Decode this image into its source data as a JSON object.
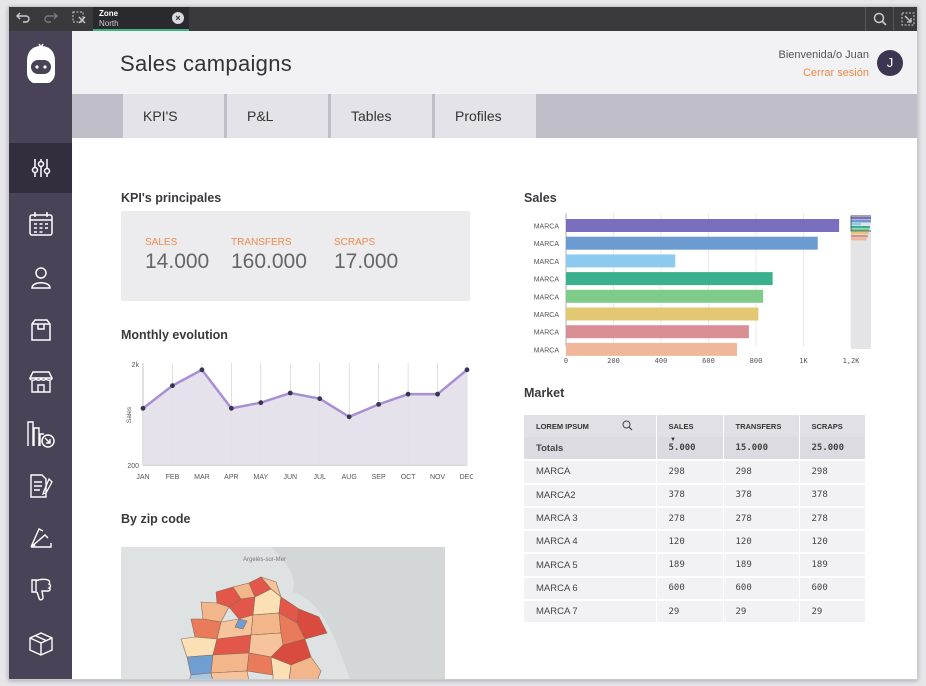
{
  "toolbar": {
    "undo_icon": "undo-icon",
    "redo_icon": "redo-icon",
    "close_icon": "close-icon",
    "zone_title": "Zone",
    "zone_sub": "North",
    "zone_close": "×"
  },
  "header": {
    "title": "Sales campaigns",
    "welcome": "Bienvenida/o Juan",
    "logout": "Cerrar sesión",
    "avatar": "J"
  },
  "tabs": [
    "KPI'S",
    "P&L",
    "Tables",
    "Profiles"
  ],
  "kpi": {
    "title": "KPI's principales",
    "items": [
      {
        "label": "SALES",
        "value": "14.000"
      },
      {
        "label": "TRANSFERS",
        "value": "160.000"
      },
      {
        "label": "SCRAPS",
        "value": "17.000"
      }
    ]
  },
  "monthly": {
    "title": "Monthly evolution"
  },
  "zip": {
    "title": "By zip code",
    "map_label": "Argelès-sur-Mer"
  },
  "sales": {
    "title": "Sales"
  },
  "market": {
    "title": "Market",
    "columns": [
      "LOREM IPSUM",
      "SALES",
      "TRANSFERS",
      "SCRAPS"
    ],
    "total": [
      "Totals",
      "5.000",
      "15.000",
      "25.000"
    ],
    "rows": [
      [
        "MARCA",
        "298",
        "298",
        "298"
      ],
      [
        "MARCA2",
        "378",
        "378",
        "378"
      ],
      [
        "MARCA 3",
        "278",
        "278",
        "278"
      ],
      [
        "MARCA 4",
        "120",
        "120",
        "120"
      ],
      [
        "MARCA 5",
        "189",
        "189",
        "189"
      ],
      [
        "MARCA 6",
        "600",
        "600",
        "600"
      ],
      [
        "MARCA 7",
        "29",
        "29",
        "29"
      ]
    ]
  },
  "colors": {
    "accent": "#f08a4b",
    "sidebar": "#4a4358",
    "line": "#a78fd6"
  },
  "chart_data": [
    {
      "type": "area",
      "title": "Monthly evolution",
      "ylabel": "Sales",
      "categories": [
        "JAN",
        "FEB",
        "MAR",
        "APR",
        "MAY",
        "JUN",
        "JUL",
        "AUG",
        "SEP",
        "OCT",
        "NOV",
        "DEC"
      ],
      "values": [
        1200,
        1600,
        1880,
        1200,
        1300,
        1470,
        1370,
        1050,
        1270,
        1450,
        1450,
        1880
      ],
      "yticks": [
        "2k",
        "200"
      ],
      "ylim": [
        200,
        2000
      ],
      "grid": true
    },
    {
      "type": "bar",
      "orientation": "horizontal",
      "title": "Sales",
      "categories": [
        "MARCA",
        "MARCA",
        "MARCA",
        "MARCA",
        "MARCA",
        "MARCA",
        "MARCA",
        "MARCA"
      ],
      "values": [
        1150,
        1060,
        460,
        870,
        830,
        810,
        770,
        720
      ],
      "colors": [
        "#7a6fbf",
        "#6c9bd2",
        "#8ccbef",
        "#3bb08f",
        "#7fcc8a",
        "#e2c873",
        "#d98e96",
        "#f0b89a"
      ],
      "xticks": [
        "0",
        "200",
        "400",
        "600",
        "800",
        "1K",
        "1,2K"
      ],
      "xlim": [
        0,
        1200
      ]
    }
  ]
}
